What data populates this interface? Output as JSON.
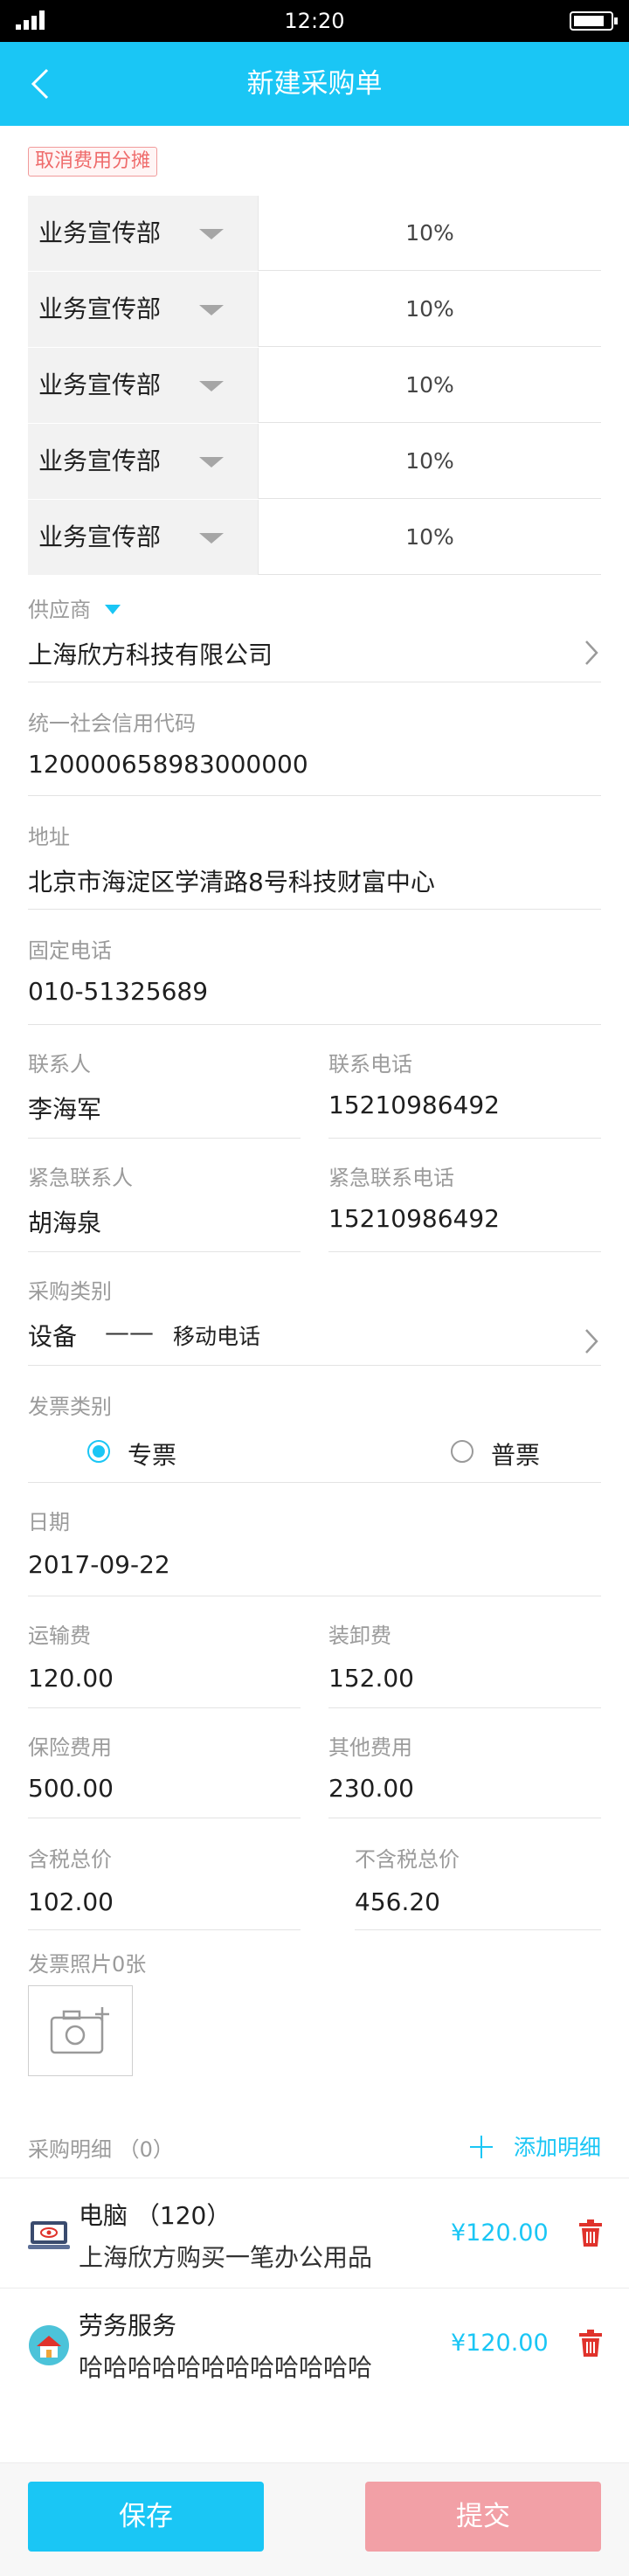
{
  "status_bar": {
    "time": "12:20"
  },
  "nav": {
    "title": "新建采购单"
  },
  "cancel_allocation_label": "取消费用分摊",
  "allocations": [
    {
      "dept": "业务宣传部",
      "percent": "10%"
    },
    {
      "dept": "业务宣传部",
      "percent": "10%"
    },
    {
      "dept": "业务宣传部",
      "percent": "10%"
    },
    {
      "dept": "业务宣传部",
      "percent": "10%"
    },
    {
      "dept": "业务宣传部",
      "percent": "10%"
    }
  ],
  "supplier": {
    "label": "供应商",
    "value": "上海欣方科技有限公司"
  },
  "credit_code": {
    "label": "统一社会信用代码",
    "value": "120000658983000000"
  },
  "address": {
    "label": "地址",
    "value": "北京市海淀区学清路8号科技财富中心"
  },
  "landline": {
    "label": "固定电话",
    "value": "010-51325689"
  },
  "contact": {
    "label": "联系人",
    "value": "李海军"
  },
  "contact_phone": {
    "label": "联系电话",
    "value": "15210986492"
  },
  "emergency_contact": {
    "label": "紧急联系人",
    "value": "胡海泉"
  },
  "emergency_phone": {
    "label": "紧急联系电话",
    "value": "15210986492"
  },
  "purchase_category": {
    "label": "采购类别",
    "main": "设备",
    "dash": "——",
    "sub": "移动电话"
  },
  "invoice_type": {
    "label": "发票类别",
    "options": [
      "专票",
      "普票"
    ],
    "selected": "专票"
  },
  "date": {
    "label": "日期",
    "value": "2017-09-22"
  },
  "freight": {
    "label": "运输费",
    "value": "120.00"
  },
  "handling": {
    "label": "装卸费",
    "value": "152.00"
  },
  "insurance": {
    "label": "保险费用",
    "value": "500.00"
  },
  "other_fee": {
    "label": "其他费用",
    "value": "230.00"
  },
  "tax_included": {
    "label": "含税总价",
    "value": "102.00"
  },
  "tax_excluded": {
    "label": "不含税总价",
    "value": "456.20"
  },
  "invoice_photos": {
    "label": "发票照片0张"
  },
  "purchase_details": {
    "label": "采购明细 （0）",
    "add_label": "添加明细",
    "items": [
      {
        "title": "电脑 （120）",
        "desc": "上海欣方购买一笔办公用品",
        "price": "¥120.00",
        "icon": "computer-icon"
      },
      {
        "title": "劳务服务",
        "desc": "哈哈哈哈哈哈哈哈哈哈哈哈",
        "price": "¥120.00",
        "icon": "service-house-icon"
      }
    ]
  },
  "actions": {
    "save": "保存",
    "submit": "提交"
  },
  "colors": {
    "accent": "#1ac6f5",
    "submit_disabled": "#f2a0a6",
    "delete": "#e0322b",
    "cancel_tag": "#ef6b6b"
  }
}
